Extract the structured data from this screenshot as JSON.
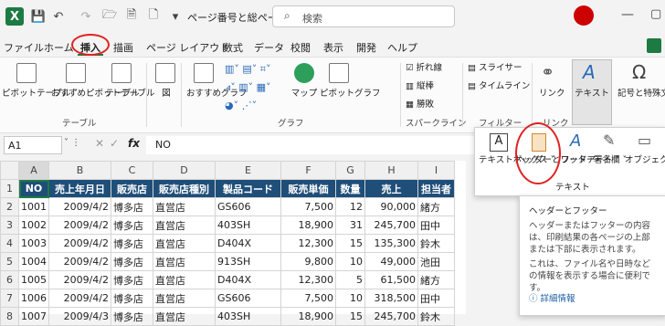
{
  "titlebar": {
    "title": "ページ番号と総ページ.xlsx ···",
    "search_placeholder": "検索"
  },
  "menu": [
    "ファイル",
    "ホーム",
    "挿入",
    "描画",
    "ページ レイアウト",
    "数式",
    "データ",
    "校閲",
    "表示",
    "開発",
    "ヘルプ"
  ],
  "ribbon": {
    "pivot_label": "ピボットテーブル ˅",
    "rec_pivot_label": "おすすめピボットテーブル",
    "table_label": "テーブル",
    "group_table": "テーブル",
    "figure_label": "図",
    "rec_graph_label": "おすすめグラフ",
    "map_label": "マップ",
    "pivot_graph_label": "ピボットグラフ",
    "group_graph": "グラフ",
    "spark_line": "折れ線",
    "spark_col": "縦棒",
    "spark_winloss": "勝敗",
    "group_spark": "スパークライン",
    "slicer": "スライサー",
    "timeline": "タイムライン",
    "group_filter": "フィルター",
    "link_label": "リンク",
    "group_link": "リンク",
    "text_label": "テキスト",
    "symbols_label": "記号と特殊文字"
  },
  "formula_bar": {
    "cell": "A1",
    "fx": "fx",
    "value": "NO"
  },
  "columns": [
    "A",
    "B",
    "C",
    "D",
    "E",
    "F",
    "G",
    "H",
    "I"
  ],
  "headers": [
    "NO",
    "売上年月日",
    "販売店",
    "販売店種別",
    "製品コード",
    "販売単価",
    "数量",
    "売上",
    "担当者"
  ],
  "rows": [
    [
      "1001",
      "2009/4/2",
      "博多店",
      "直営店",
      "GS606",
      "7,500",
      "12",
      "90,000",
      "緒方"
    ],
    [
      "1002",
      "2009/4/2",
      "博多店",
      "直営店",
      "403SH",
      "18,900",
      "31",
      "245,700",
      "田中"
    ],
    [
      "1003",
      "2009/4/2",
      "博多店",
      "直営店",
      "D404X",
      "12,300",
      "15",
      "135,300",
      "鈴木"
    ],
    [
      "1004",
      "2009/4/2",
      "博多店",
      "直営店",
      "913SH",
      "9,800",
      "10",
      "49,000",
      "池田"
    ],
    [
      "1005",
      "2009/4/2",
      "博多店",
      "直営店",
      "D404X",
      "12,300",
      "5",
      "61,500",
      "緒方"
    ],
    [
      "1006",
      "2009/4/2",
      "博多店",
      "直営店",
      "GS606",
      "7,500",
      "10",
      "318,500",
      "田中"
    ],
    [
      "1007",
      "2009/4/3",
      "博多店",
      "直営店",
      "403SH",
      "18,900",
      "15",
      "245,700",
      "鈴木"
    ]
  ],
  "row_numbers": [
    "1",
    "2",
    "3",
    "4",
    "5",
    "6",
    "7",
    "8"
  ],
  "dropdown": {
    "textbox": "テキストボックス ˅",
    "header_footer": "ヘッダーとフッター",
    "wordart": "ワードアート ˅",
    "signature": "署名欄 ˅",
    "object": "オブジェクト",
    "group": "テキスト"
  },
  "tooltip": {
    "title": "ヘッダーとフッター",
    "body1": "ヘッダーまたはフッターの内容は、印刷結果の各ページの上部または下部に表示されます。",
    "body2": "これは、ファイル名や日時などの情報を表示する場合に便利です。",
    "more": "詳細情報"
  },
  "colors": {
    "header_bg": "#1f4e79",
    "accent_red": "#e02020"
  }
}
